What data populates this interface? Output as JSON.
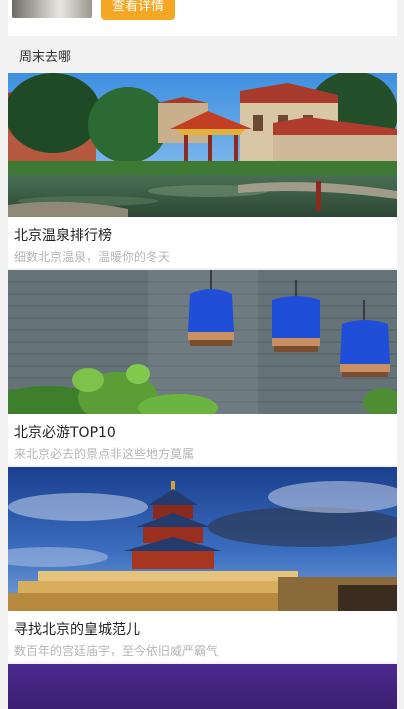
{
  "top_card": {
    "detail_button_label": "查看详情"
  },
  "section": {
    "title": "周末去哪"
  },
  "cards": [
    {
      "title": "北京温泉排行榜",
      "subtitle": "细数北京温泉，温暖你的冬天",
      "image_icon": "garden-pavilion-image"
    },
    {
      "title": "北京必游TOP10",
      "subtitle": "来北京必去的景点非这些地方莫属",
      "image_icon": "birdcage-wall-image"
    },
    {
      "title": "寻找北京的皇城范儿",
      "subtitle": "数百年的宫廷庙宇，至今依旧威严霸气",
      "image_icon": "temple-of-heaven-image"
    }
  ],
  "colors": {
    "accent": "#f5a623",
    "title_text": "#222222",
    "subtitle_text": "#b5b5b5",
    "background": "#f2f2f2"
  }
}
